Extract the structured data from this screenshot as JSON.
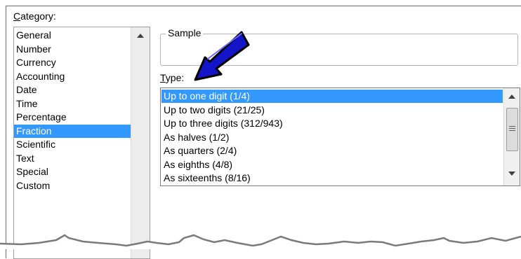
{
  "category": {
    "label": "Category:",
    "items": [
      "General",
      "Number",
      "Currency",
      "Accounting",
      "Date",
      "Time",
      "Percentage",
      "Fraction",
      "Scientific",
      "Text",
      "Special",
      "Custom"
    ],
    "selected_index": 7
  },
  "sample": {
    "label": "Sample",
    "value": ""
  },
  "type": {
    "label": "Type:",
    "items": [
      "Up to one digit (1/4)",
      "Up to two digits (21/25)",
      "Up to three digits (312/943)",
      "As halves (1/2)",
      "As quarters (2/4)",
      "As eighths (4/8)",
      "As sixteenths (8/16)"
    ],
    "selected_index": 0
  },
  "colors": {
    "selection": "#3399ff",
    "arrow_fill": "#1414c8",
    "arrow_outline": "#000000"
  },
  "icons": [
    "scroll-up-arrow-icon",
    "scroll-down-arrow-icon",
    "scroll-thumb-grip-icon",
    "pointer-arrow-icon"
  ]
}
